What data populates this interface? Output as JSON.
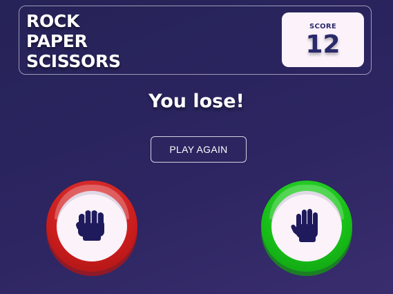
{
  "header": {
    "title_lines": [
      "ROCK",
      "PAPER",
      "SCISSORS"
    ],
    "score_label": "SCORE",
    "score_value": "12"
  },
  "result": {
    "message": "You lose!",
    "play_again_label": "PLAY AGAIN"
  },
  "choices": {
    "player": {
      "pick": "rock",
      "icon": "rock-fist-icon",
      "ring_color": "#c91c1c"
    },
    "house": {
      "pick": "paper",
      "icon": "paper-hand-icon",
      "ring_color": "#17bc17"
    }
  },
  "colors": {
    "background": "#2c2561",
    "icon": "#1e1a5c",
    "panel": "#fbf2fa",
    "score_text": "#2a2a6a"
  }
}
